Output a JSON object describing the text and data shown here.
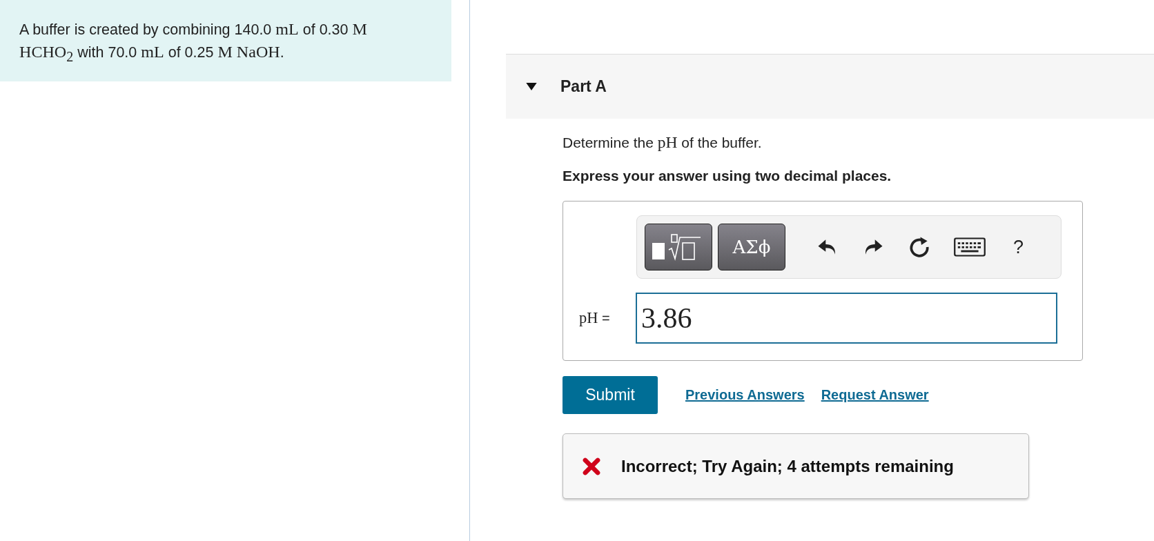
{
  "problem": {
    "segments": [
      {
        "kind": "text",
        "text": "A buffer is created by combining 140.0 "
      },
      {
        "kind": "math",
        "text": "mL"
      },
      {
        "kind": "text",
        "text": " of 0.30 "
      },
      {
        "kind": "math",
        "text": "M HCHO$_{2}$"
      },
      {
        "kind": "text",
        "text": " with 70.0 "
      },
      {
        "kind": "math",
        "text": "mL"
      },
      {
        "kind": "text",
        "text": " of 0.25 "
      },
      {
        "kind": "math",
        "text": "M NaOH"
      },
      {
        "kind": "text",
        "text": "."
      }
    ]
  },
  "part": {
    "title": "Part A",
    "expanded": true,
    "question": [
      {
        "kind": "text",
        "text": "Determine the "
      },
      {
        "kind": "math",
        "text": "pH"
      },
      {
        "kind": "text",
        "text": " of the buffer."
      }
    ],
    "instruction": "Express your answer using two decimal places.",
    "toolbar": [
      {
        "kind": "templates"
      },
      {
        "kind": "text",
        "label": "ΑΣϕ"
      },
      {
        "kind": "undo"
      },
      {
        "kind": "redo"
      },
      {
        "kind": "reset"
      },
      {
        "kind": "keyboard"
      },
      {
        "kind": "plain",
        "label": "?"
      }
    ],
    "answer_label": [
      {
        "kind": "math",
        "text": "pH"
      },
      {
        "kind": "text",
        "text": " ="
      }
    ],
    "answer_value": "3.86",
    "submit": "Submit",
    "links": [
      "Previous Answers",
      "Request Answer"
    ],
    "feedback": {
      "correct": false,
      "message": "Incorrect; Try Again; 4 attempts remaining"
    }
  }
}
